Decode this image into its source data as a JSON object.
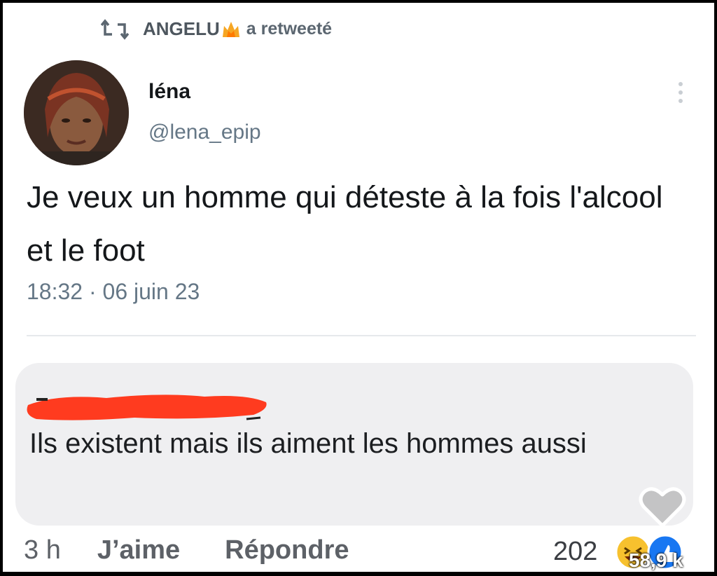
{
  "retweet": {
    "icon": "retweet-icon",
    "retweeter": "ANGELU",
    "retweeter_emoji": "fire-crown-icon",
    "action": "a retweeté"
  },
  "tweet": {
    "author_name": "léna",
    "author_handle": "@lena_epip",
    "text": "Je veux un homme qui déteste à la fois l'alcool et le foot",
    "timestamp": "18:32 · 06 juin 23"
  },
  "comment": {
    "author_redacted": true,
    "text": "Ils existent mais ils aiment les hommes aussi",
    "time": "3 h",
    "like_label": "J’aime",
    "reply_label": "Répondre",
    "reaction_count": "202",
    "reactions_total": "58,9 k"
  },
  "colors": {
    "accent_gray": "#657786",
    "bubble_bg": "#efeff1",
    "redaction": "#ff3b1f",
    "like_blue": "#1877f2",
    "haha_yellow": "#f7c12e"
  }
}
